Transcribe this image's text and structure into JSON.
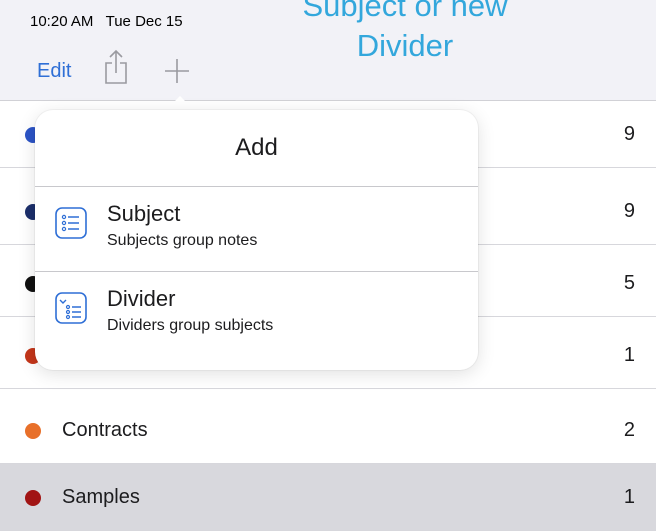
{
  "status_bar": {
    "time_date": "10:20 AM   Tue Dec 15"
  },
  "overlay_caption": {
    "line1": "Subject or new",
    "line2": "Divider"
  },
  "toolbar": {
    "edit_label": "Edit",
    "share_icon": "share-icon",
    "add_icon": "plus-icon"
  },
  "popover": {
    "title": "Add",
    "items": [
      {
        "title": "Subject",
        "subtitle": "Subjects group notes",
        "icon": "subject-list-icon"
      },
      {
        "title": "Divider",
        "subtitle": "Dividers group subjects",
        "icon": "divider-list-icon"
      }
    ]
  },
  "subjects": [
    {
      "name": "",
      "count": "9",
      "color": "#2c54c6"
    },
    {
      "name": "",
      "count": "9",
      "color": "#1c2f6b"
    },
    {
      "name": "",
      "count": "5",
      "color": "#111111"
    },
    {
      "name": "",
      "count": "1",
      "color": "#c4361a"
    },
    {
      "name": "Contracts",
      "count": "2",
      "color": "#e8702a"
    },
    {
      "name": "Samples",
      "count": "1",
      "color": "#a11414",
      "selected": true
    }
  ],
  "colors": {
    "accent": "#2f6fd6",
    "caption": "#33a7dc",
    "toolbar_bg": "#f2f2f7",
    "selected_row": "#d8d8dd"
  }
}
